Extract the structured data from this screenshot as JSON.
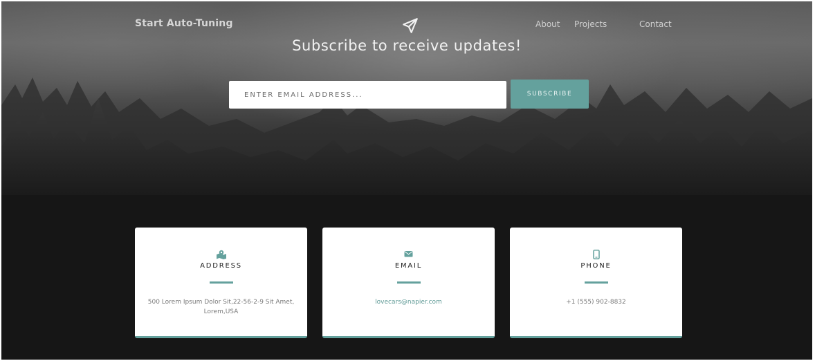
{
  "header": {
    "brand": "Start Auto-Tuning",
    "logo_icon": "paper-plane-icon",
    "nav": [
      {
        "label": "About"
      },
      {
        "label": "Projects"
      },
      {
        "label": "Contact"
      }
    ]
  },
  "subscribe": {
    "headline": "Subscribe to receive updates!",
    "input_placeholder": "Enter email address...",
    "button_label": "SUBSCRIBE"
  },
  "contact_cards": [
    {
      "icon": "map-marked-icon",
      "title": "ADDRESS",
      "text": "500 Lorem Ipsum Dolor Sit,22-56-2-9 Sit Amet, Lorem,USA"
    },
    {
      "icon": "envelope-icon",
      "title": "EMAIL",
      "text": "lovecars@napier.com"
    },
    {
      "icon": "mobile-phone-icon",
      "title": "PHONE",
      "text": "+1 (555) 902-8832"
    }
  ],
  "colors": {
    "accent": "#64a19d",
    "background": "#161616",
    "card": "#ffffff"
  }
}
